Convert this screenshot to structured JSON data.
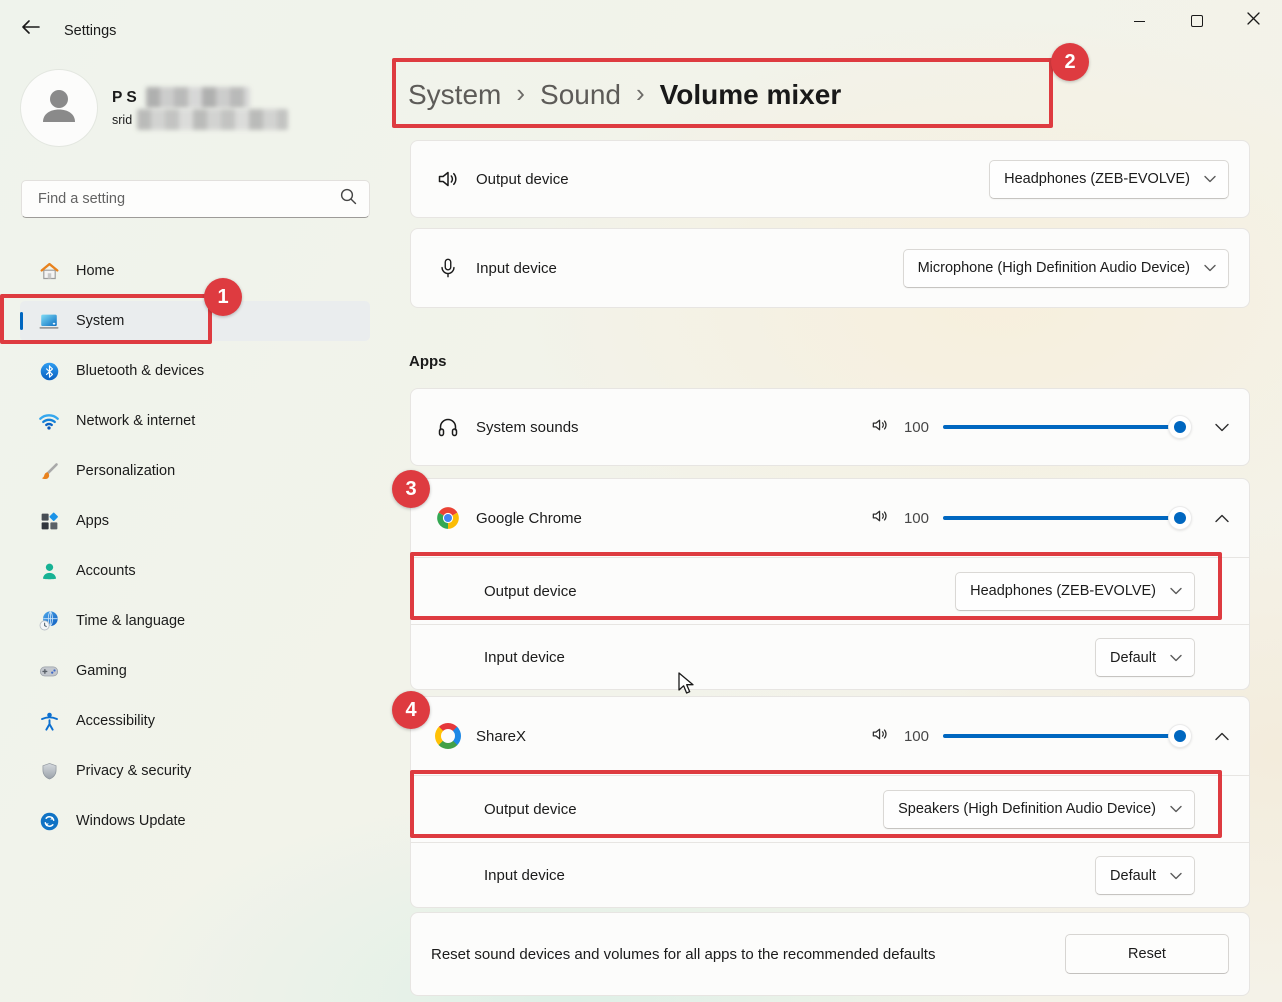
{
  "window": {
    "title": "Settings"
  },
  "profile": {
    "name": "P S",
    "email": "srid"
  },
  "search": {
    "placeholder": "Find a setting"
  },
  "sidebar": {
    "items": [
      {
        "label": "Home",
        "icon": "home-icon"
      },
      {
        "label": "System",
        "icon": "system-icon",
        "selected": true
      },
      {
        "label": "Bluetooth & devices",
        "icon": "bluetooth-icon"
      },
      {
        "label": "Network & internet",
        "icon": "network-icon"
      },
      {
        "label": "Personalization",
        "icon": "personalization-icon"
      },
      {
        "label": "Apps",
        "icon": "apps-icon"
      },
      {
        "label": "Accounts",
        "icon": "accounts-icon"
      },
      {
        "label": "Time & language",
        "icon": "time-language-icon"
      },
      {
        "label": "Gaming",
        "icon": "gaming-icon"
      },
      {
        "label": "Accessibility",
        "icon": "accessibility-icon"
      },
      {
        "label": "Privacy & security",
        "icon": "privacy-icon"
      },
      {
        "label": "Windows Update",
        "icon": "windows-update-icon"
      }
    ]
  },
  "breadcrumb": {
    "level1": "System",
    "level2": "Sound",
    "current": "Volume mixer",
    "separator": "›"
  },
  "devices": {
    "output": {
      "label": "Output device",
      "value": "Headphones (ZEB-EVOLVE)"
    },
    "input": {
      "label": "Input device",
      "value": "Microphone (High Definition Audio Device)"
    }
  },
  "apps": {
    "heading": "Apps",
    "system_sounds": {
      "name": "System sounds",
      "volume": "100",
      "expanded": false
    },
    "chrome": {
      "name": "Google Chrome",
      "volume": "100",
      "expanded": true,
      "output": {
        "label": "Output device",
        "value": "Headphones (ZEB-EVOLVE)"
      },
      "input": {
        "label": "Input device",
        "value": "Default"
      }
    },
    "sharex": {
      "name": "ShareX",
      "volume": "100",
      "expanded": true,
      "output": {
        "label": "Output device",
        "value": "Speakers (High Definition Audio Device)"
      },
      "input": {
        "label": "Input device",
        "value": "Default"
      }
    }
  },
  "reset": {
    "text": "Reset sound devices and volumes for all apps to the recommended defaults",
    "button": "Reset"
  },
  "annotations": {
    "badge1": "1",
    "badge2": "2",
    "badge3": "3",
    "badge4": "4"
  },
  "colors": {
    "accent": "#0067C0",
    "annotation": "#DE3B40",
    "slider": "#0067C0"
  }
}
